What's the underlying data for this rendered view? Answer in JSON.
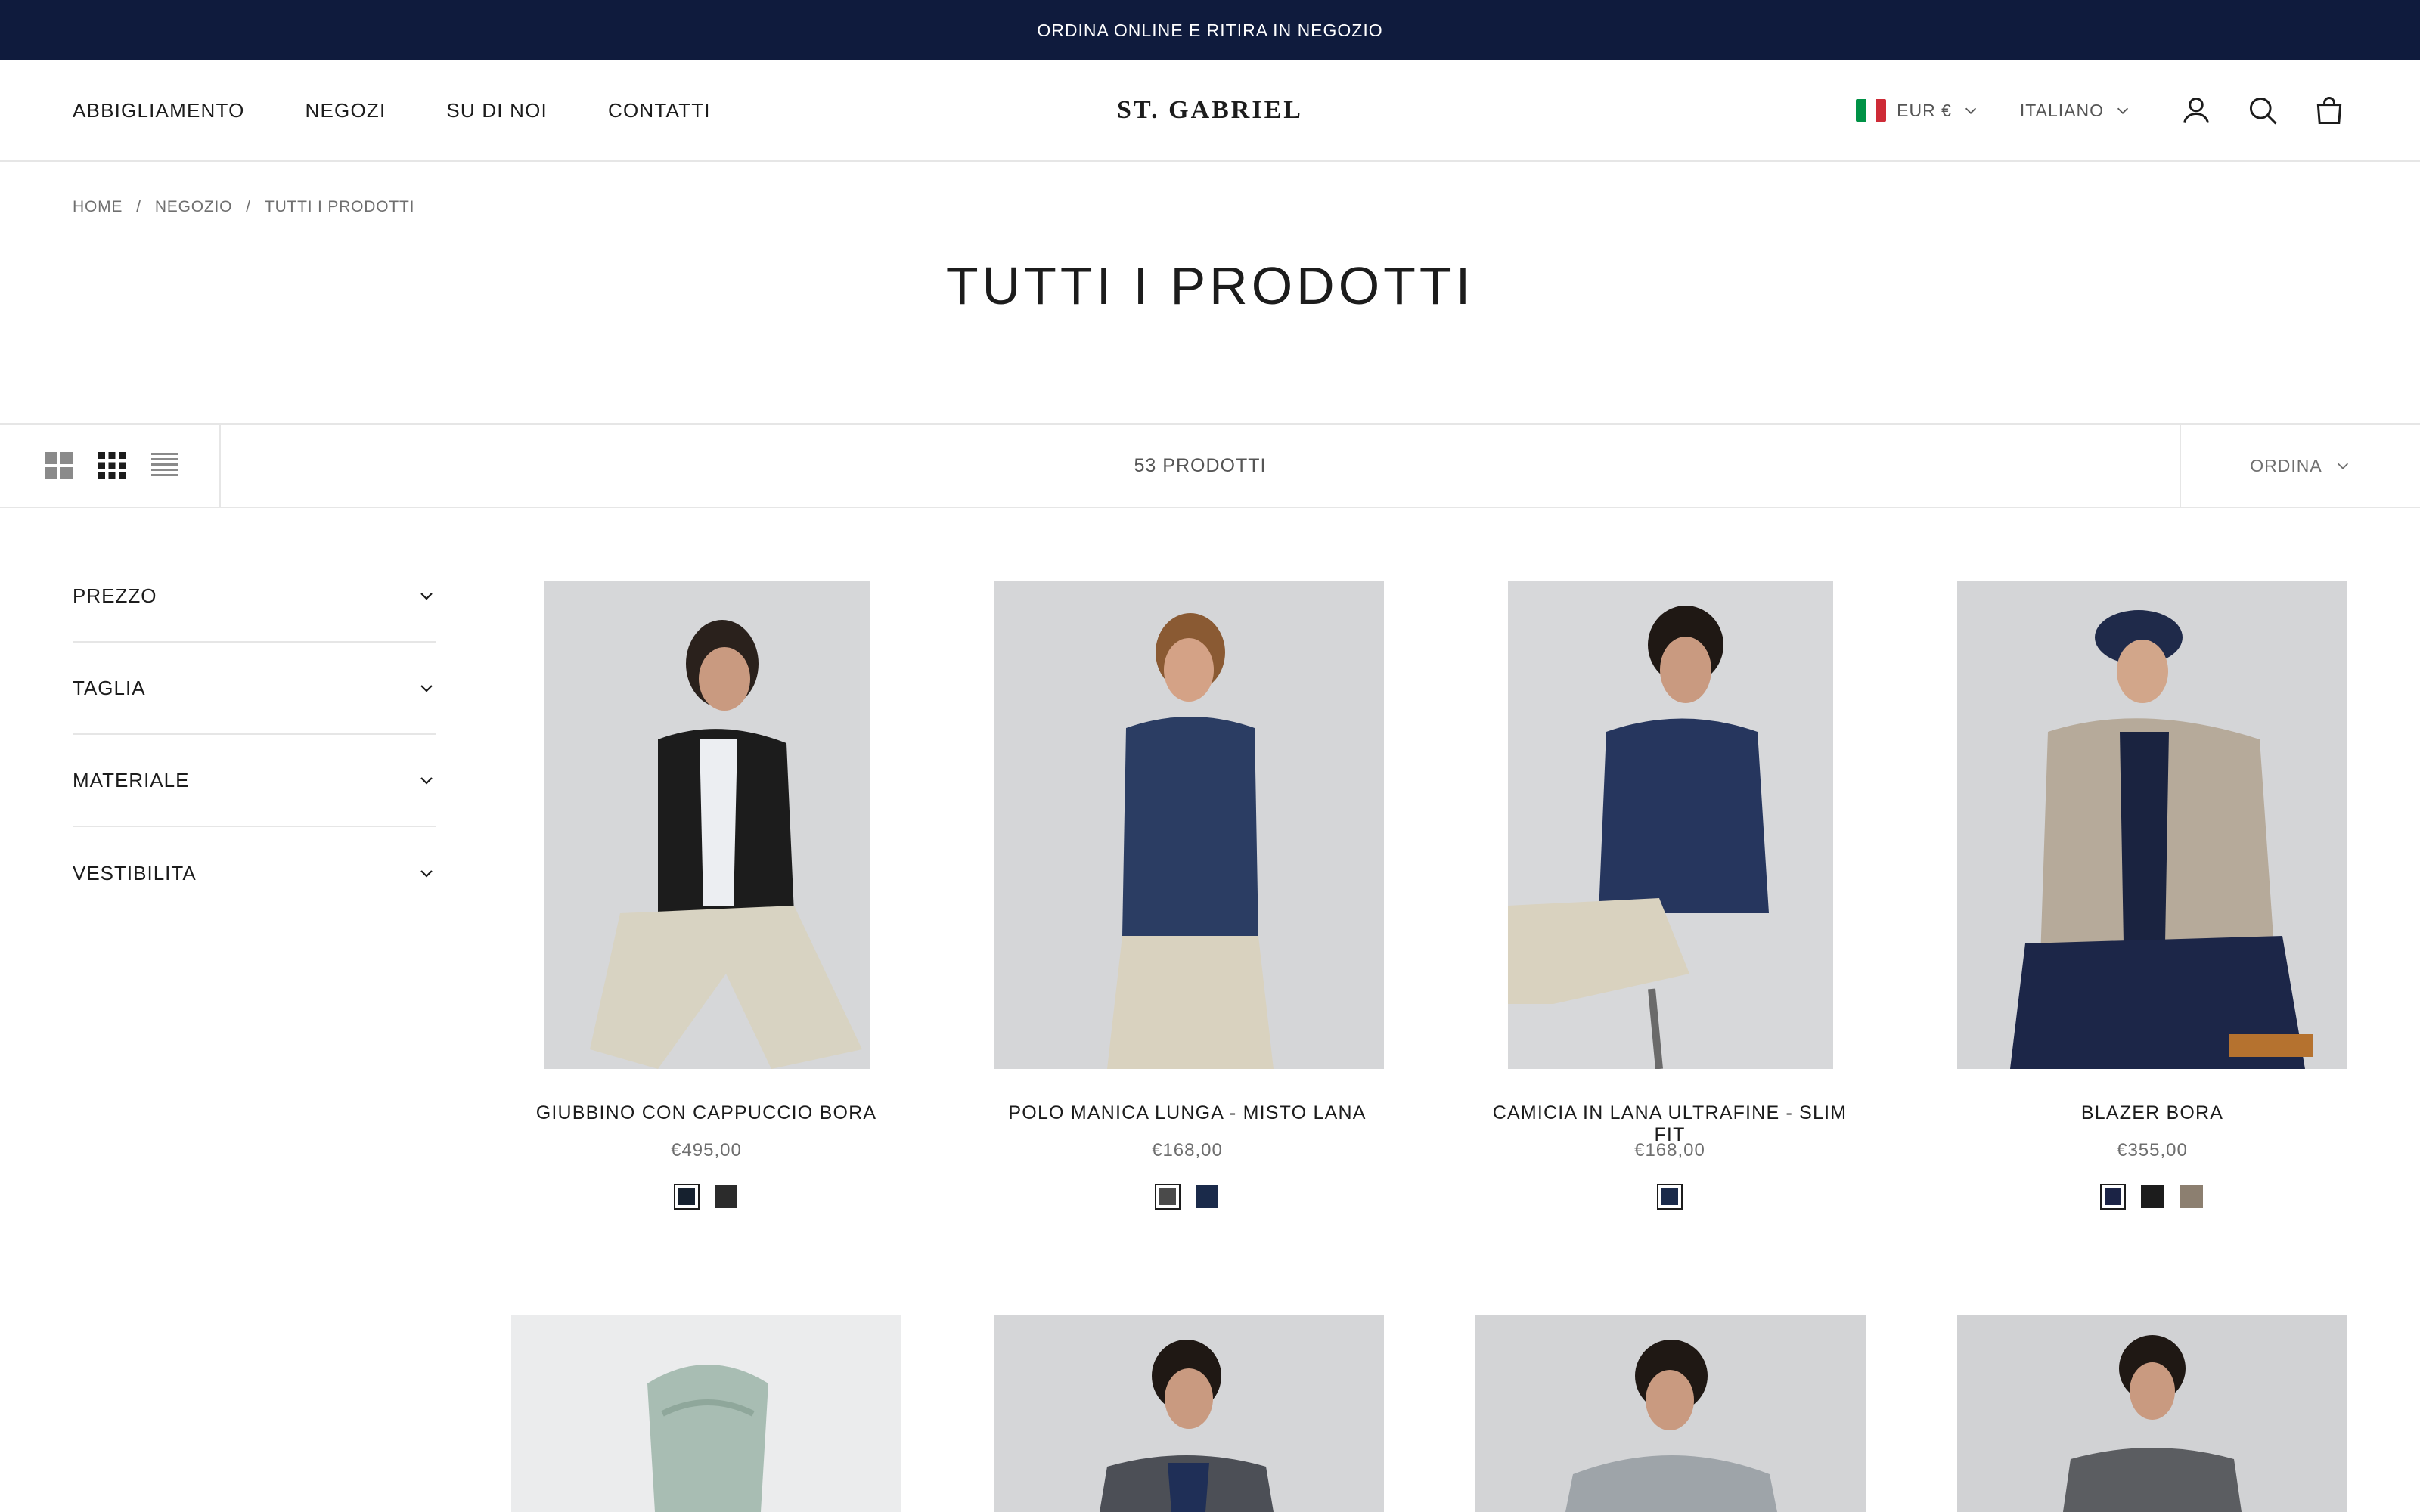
{
  "announcement": "ORDINA ONLINE E RITIRA IN NEGOZIO",
  "nav": {
    "items": [
      "ABBIGLIAMENTO",
      "NEGOZI",
      "SU DI NOI",
      "CONTATTI"
    ]
  },
  "brand": "ST. GABRIEL",
  "header": {
    "currency": "EUR €",
    "language": "ITALIANO",
    "icons": [
      "account-icon",
      "search-icon",
      "cart-icon"
    ],
    "flag_colors": [
      "#009246",
      "#ffffff",
      "#ce2b37"
    ]
  },
  "breadcrumb": [
    "HOME",
    "/",
    "NEGOZIO",
    "/",
    "TUTTI I PRODOTTI"
  ],
  "page_title": "TUTTI I PRODOTTI",
  "toolbar": {
    "views": [
      "grid-large-icon",
      "grid-small-icon",
      "list-icon"
    ],
    "count": "53 PRODOTTI",
    "sort": "ORDINA"
  },
  "filters": [
    "PREZZO",
    "TAGLIA",
    "MATERIALE",
    "VESTIBILITA"
  ],
  "products": [
    {
      "name": "GIUBBINO CON CAPPUCCIO BORA",
      "price": "€495,00",
      "swatches": [
        "#16212f",
        "#2b2b2b"
      ],
      "selected": 0
    },
    {
      "name": "POLO MANICA LUNGA - MISTO LANA",
      "price": "€168,00",
      "swatches": [
        "#4a4a4a",
        "#1a2a4a"
      ],
      "selected": 0
    },
    {
      "name": "CAMICIA IN LANA ULTRAFINE - SLIM FIT",
      "price": "€168,00",
      "swatches": [
        "#1a2a4a"
      ],
      "selected": 0
    },
    {
      "name": "BLAZER BORA",
      "price": "€355,00",
      "swatches": [
        "#1b2345",
        "#1c1c1c",
        "#8c7f70"
      ],
      "selected": 0
    },
    {
      "name": "",
      "price": "",
      "swatches": []
    },
    {
      "name": "",
      "price": "",
      "swatches": []
    },
    {
      "name": "",
      "price": "",
      "swatches": []
    },
    {
      "name": "",
      "price": "",
      "swatches": []
    }
  ],
  "colors": {
    "announcement_bg": "#0f1b3d",
    "text": "#1c1c1c",
    "muted": "#6f6f6f",
    "border": "#e6e6e6"
  }
}
